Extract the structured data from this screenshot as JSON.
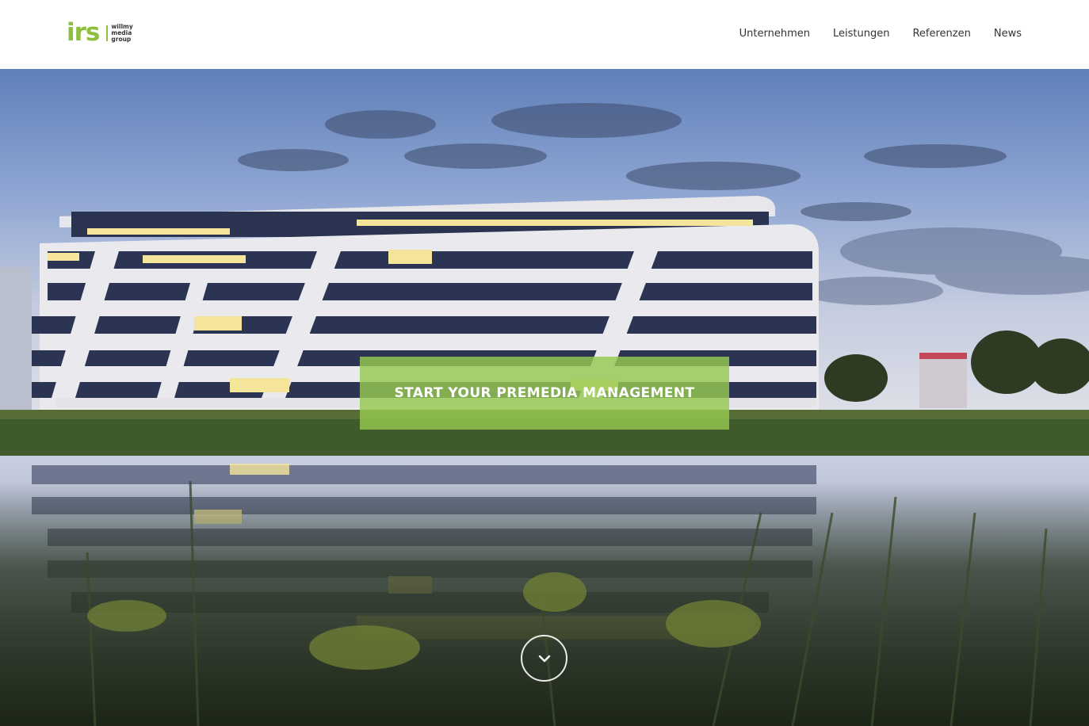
{
  "header": {
    "logo": {
      "mark": "irs",
      "group_lines": [
        "willmy",
        "media",
        "group"
      ]
    },
    "nav": [
      "Unternehmen",
      "Leistungen",
      "Referenzen",
      "News"
    ]
  },
  "hero": {
    "cta_label": "START YOUR PREMEDIA MANAGEMENT",
    "scroll_icon": "chevron-down-icon"
  },
  "colors": {
    "brand_green": "#8fbf3f",
    "nav_text": "#333333"
  }
}
